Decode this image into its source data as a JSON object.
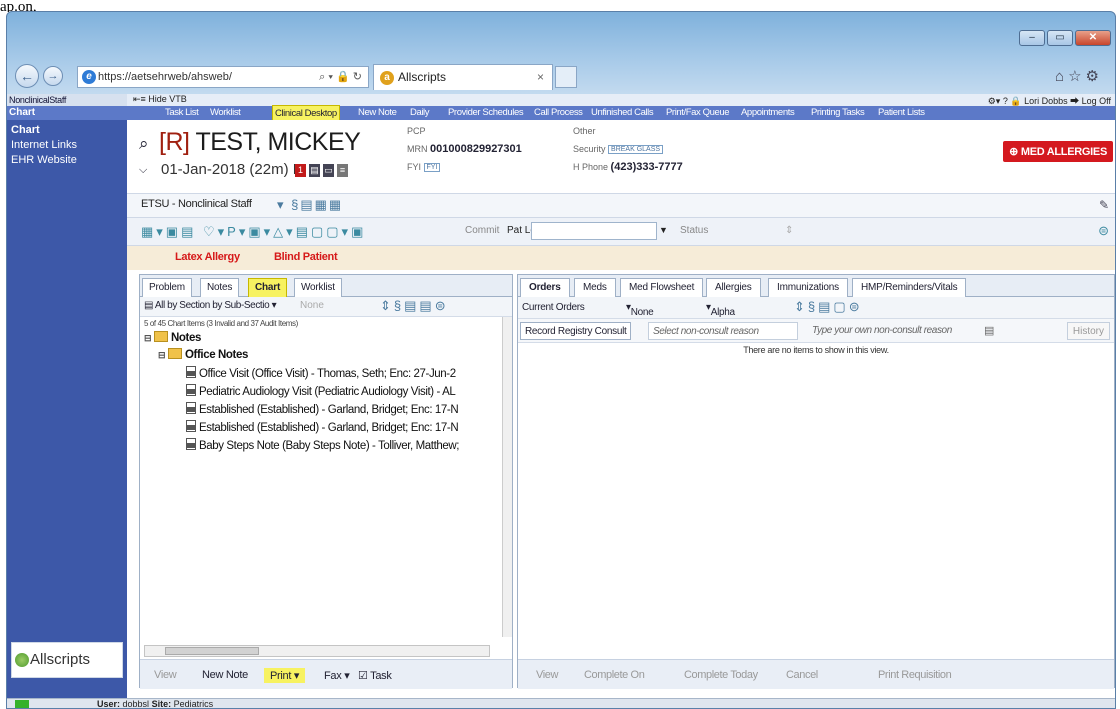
{
  "top_text": "ap.on,",
  "browser": {
    "url": "https://aetsehrweb/ahsweb/",
    "tab_title": "Allscripts",
    "tab_close": "×",
    "address_tools": "⌕ ▾ 🔒 ↻"
  },
  "toolbar": {
    "hide_vtb": "Hide VTB",
    "user_name": "Lori Dobbs",
    "log_off": "Log Off"
  },
  "sidebar": {
    "user": "NonclinicalStaff",
    "header": "Chart",
    "items": [
      {
        "label": "Chart"
      },
      {
        "label": "Internet Links"
      },
      {
        "label": "EHR Website"
      }
    ],
    "logo_text": "Allscripts"
  },
  "menu": {
    "items": [
      {
        "label": "Task List"
      },
      {
        "label": "Worklist"
      },
      {
        "label": "Clinical Desktop"
      },
      {
        "label": "New Note"
      },
      {
        "label": "Daily"
      },
      {
        "label": "Provider Schedules"
      },
      {
        "label": "Call Process"
      },
      {
        "label": "Unfinished Calls"
      },
      {
        "label": "Print/Fax Queue"
      },
      {
        "label": "Appointments"
      },
      {
        "label": "Printing Tasks"
      },
      {
        "label": "Patient Lists"
      }
    ],
    "active_index": 2
  },
  "patient": {
    "restricted_marker": "[R]",
    "name": "TEST, MICKEY",
    "dob_line": "01-Jan-2018 (22m) F",
    "pcp_label": "PCP",
    "mrn_label": "MRN",
    "mrn": "001000829927301",
    "fyi_label": "FYI",
    "fyi_box": "FYI",
    "other_label": "Other",
    "security_label": "Security",
    "security_box": "BREAK GLASS",
    "hphone_label": "H Phone",
    "hphone": "(423)333-7777",
    "med_allergies": "MED ALLERGIES",
    "alerts": [
      "Latex Allergy",
      "Blind Patient"
    ]
  },
  "org": {
    "selected": "ETSU - Nonclinical Staff"
  },
  "command_row": {
    "commit": "Commit",
    "pat_loc_label": "Pat Loc",
    "status_label": "Status"
  },
  "left_panel": {
    "tabs": [
      {
        "label": "Problem"
      },
      {
        "label": "Notes"
      },
      {
        "label": "Chart"
      },
      {
        "label": "Worklist"
      }
    ],
    "active_tab": 2,
    "filter_view": "All by Section by Sub-Sectio",
    "filter_none": "None",
    "count_text": "5 of 45 Chart Items (3 Invalid and 37 Audit Items)",
    "tree": {
      "root": "Notes",
      "folder": "Office Notes",
      "items": [
        "Office Visit (Office Visit) - Thomas, Seth; Enc: 27-Jun-2",
        "Pediatric Audiology Visit (Pediatric Audiology Visit) - AL",
        "Established (Established) - Garland, Bridget; Enc: 17-N",
        "Established (Established) - Garland, Bridget; Enc: 17-N",
        "Baby Steps Note (Baby Steps Note) - Tolliver, Matthew;"
      ]
    },
    "actions": {
      "view": "View",
      "new_note": "New Note",
      "print": "Print",
      "fax": "Fax",
      "task": "Task"
    }
  },
  "right_panel": {
    "tabs": [
      {
        "label": "Orders"
      },
      {
        "label": "Meds"
      },
      {
        "label": "Med Flowsheet"
      },
      {
        "label": "Allergies"
      },
      {
        "label": "Immunizations"
      },
      {
        "label": "HMP/Reminders/Vitals"
      }
    ],
    "active_tab": 0,
    "filter_orders": "Current Orders",
    "filter_none": "None",
    "filter_sort": "Alpha",
    "consult_button": "Record Registry Consult",
    "consult_select_placeholder": "Select non-consult reason",
    "consult_type_placeholder": "Type your own non-consult reason",
    "history": "History",
    "empty_message": "There are no items to show in this view.",
    "actions": {
      "view": "View",
      "complete_on": "Complete On",
      "complete_today": "Complete Today",
      "cancel": "Cancel",
      "print_requisition": "Print Requisition"
    }
  },
  "statusbar": {
    "user_label": "User:",
    "user": "dobbsl",
    "site_label": "Site:",
    "site": "Pediatrics"
  },
  "colors": {
    "sidebar": "#3d58a8",
    "menubar": "#5c79c8",
    "highlight": "#f7f261",
    "alert_red": "#d61919",
    "allergy_badge": "#d4191f"
  }
}
